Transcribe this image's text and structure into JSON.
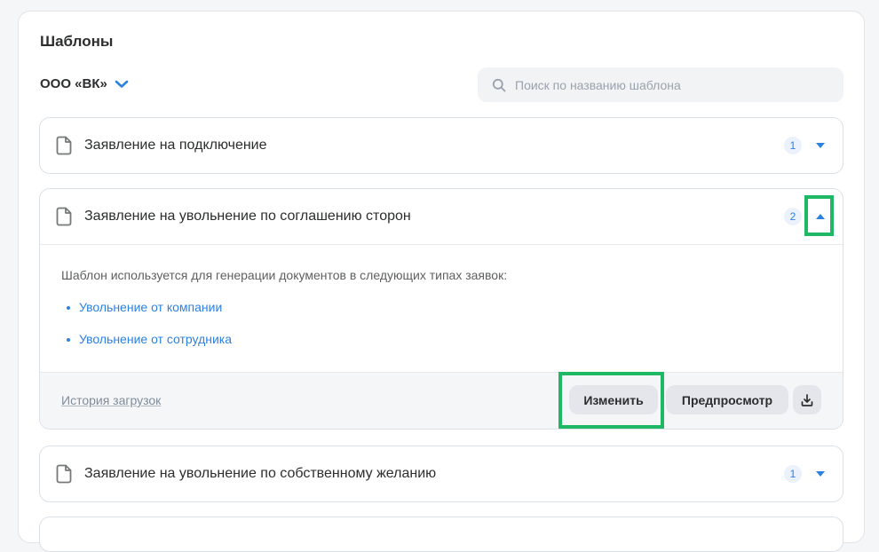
{
  "page": {
    "title": "Шаблоны",
    "org_name": "ООО «ВК»",
    "search_placeholder": "Поиск по названию шаблона"
  },
  "templates": [
    {
      "title": "Заявление на подключение",
      "count": "1",
      "expanded": false
    },
    {
      "title": "Заявление на увольнение по соглашению сторон",
      "count": "2",
      "expanded": true,
      "description": "Шаблон используется для генерации документов в следующих типах заявок:",
      "request_types": [
        "Увольнение от компании",
        "Увольнение от сотрудника"
      ],
      "history_label": "История загрузок",
      "edit_label": "Изменить",
      "preview_label": "Предпросмотр"
    },
    {
      "title": "Заявление на увольнение по собственному желанию",
      "count": "1",
      "expanded": false
    }
  ],
  "icons": [
    "chevron-down-icon",
    "search-icon",
    "document-icon",
    "caret-down-icon",
    "caret-up-icon",
    "download-icon"
  ],
  "colors": {
    "accent": "#2d81e0",
    "highlight": "#1fb864",
    "text": "#2c2d2e",
    "muted": "#818c99"
  }
}
